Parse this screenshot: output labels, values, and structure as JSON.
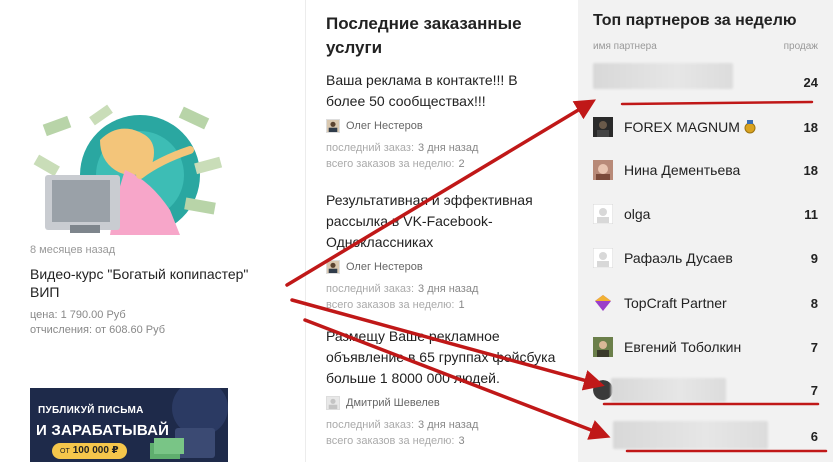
{
  "product": {
    "meta": "8 месяцев назад",
    "title": "Видео-курс \"Богатый копипастер\" ВИП",
    "price": "цена: 1 790.00 Руб",
    "commission": "отчисления: от 608.60 Руб"
  },
  "banner": {
    "line1": "ПУБЛИКУЙ ПИСЬМА",
    "line2": "И ЗАРАБАТЫВАЙ",
    "pill_prefix": "ОТ",
    "pill_value": "100 000 ₽"
  },
  "orders": {
    "heading": "Последние заказанные услуги",
    "last_order_label": "последний заказ:",
    "weekly_label": "всего заказов за неделю:",
    "items": [
      {
        "title": "Ваша реклама в контакте!!! В более 50 сообществах!!!",
        "user": "Олег Нестеров",
        "last": "3 дня назад",
        "weekly": "2"
      },
      {
        "title": "Результативная и эффективная рассылка в VK-Facebook-Одноклассниках",
        "user": "Олег Нестеров",
        "last": "3 дня назад",
        "weekly": "1"
      },
      {
        "title": "Размещу Ваше рекламное объявление в 65 группах фейсбука больше 1 8000 000 людей.",
        "user": "Дмитрий Шевелев",
        "last": "3 дня назад",
        "weekly": "3"
      }
    ]
  },
  "partners": {
    "heading": "Топ партнеров за неделю",
    "col_name": "имя партнера",
    "col_sales": "продаж",
    "items": [
      {
        "name": "",
        "count": "24"
      },
      {
        "name": "FOREX MAGNUM",
        "count": "18"
      },
      {
        "name": "Нина Дементьева",
        "count": "18"
      },
      {
        "name": "olga",
        "count": "11"
      },
      {
        "name": "Рафаэль Дусаев",
        "count": "9"
      },
      {
        "name": "TopCraft Partner",
        "count": "8"
      },
      {
        "name": "Евгений Тоболкин",
        "count": "7"
      },
      {
        "name": "",
        "count": "7"
      },
      {
        "name": "",
        "count": "6"
      }
    ]
  },
  "colors": {
    "arrow": "#c01818",
    "panel": "#f2f2f2",
    "banner_bg": "#1e2a4a",
    "pill": "#f5c64b"
  }
}
